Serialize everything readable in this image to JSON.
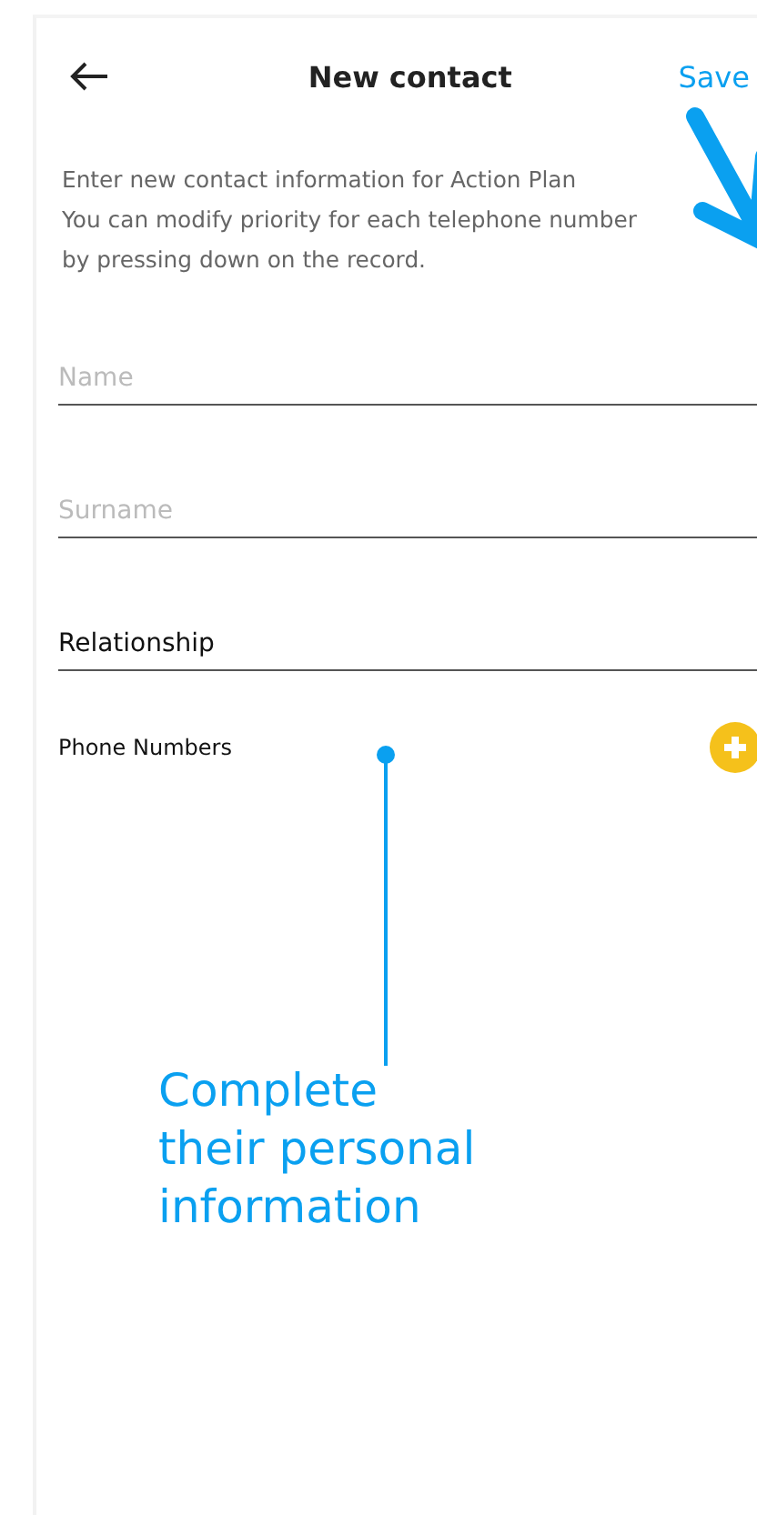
{
  "header": {
    "title": "New contact",
    "action": "Save"
  },
  "intro": "Enter new contact information for Action Plan\nYou can modify priority for each telephone number by pressing down on the record.",
  "fields": [
    {
      "placeholder": "Name"
    },
    {
      "placeholder": "Surname"
    },
    {
      "value": "Relationship"
    }
  ],
  "phones": {
    "label": "Phone Numbers"
  },
  "annotation": {
    "text": "Complete\ntheir personal\ninformation"
  }
}
